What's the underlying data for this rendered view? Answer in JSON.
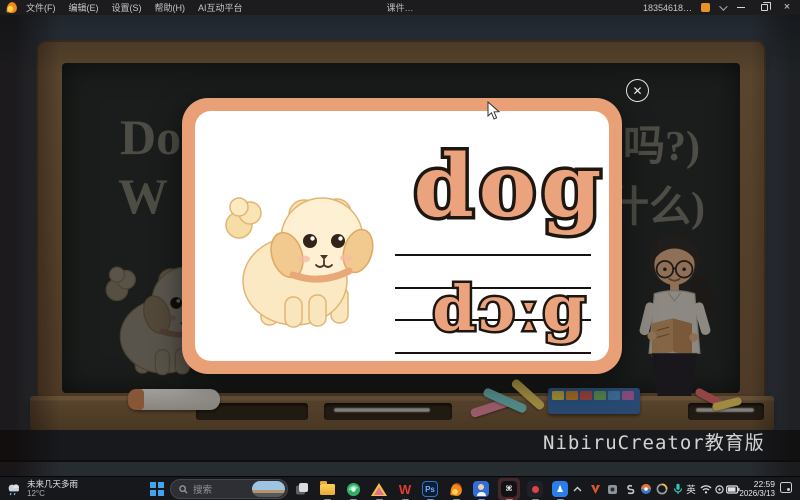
{
  "titlebar": {
    "menus": [
      "文件(F)",
      "编辑(E)",
      "设置(S)",
      "帮助(H)",
      "AI互动平台"
    ],
    "title": "课件…",
    "account": "18354618…",
    "close_glyph": "×"
  },
  "board": {
    "line1_left": "Do",
    "line1_right": "吗?)",
    "line2_left": "W",
    "line2_right": "什么)"
  },
  "card": {
    "word": "dog",
    "phonetic": "dɔːg",
    "close_glyph": "✕"
  },
  "watermark": "NibiruCreator教育版",
  "taskbar": {
    "weather_line1": "未来几天多雨",
    "weather_temp": "12°C",
    "search_placeholder": "搜索",
    "wps_label": "W",
    "photoshop_label": "Ps",
    "capcut_label": "⌘",
    "blueapp_label": "♟",
    "ime": "英",
    "time": "22:59",
    "date": "2026/3/13"
  },
  "colors": {
    "card_border": "#E9A077",
    "word_fill": "#EBA37E",
    "accent_blue": "#45a4ee",
    "taskbar_bg": "#17181c"
  }
}
